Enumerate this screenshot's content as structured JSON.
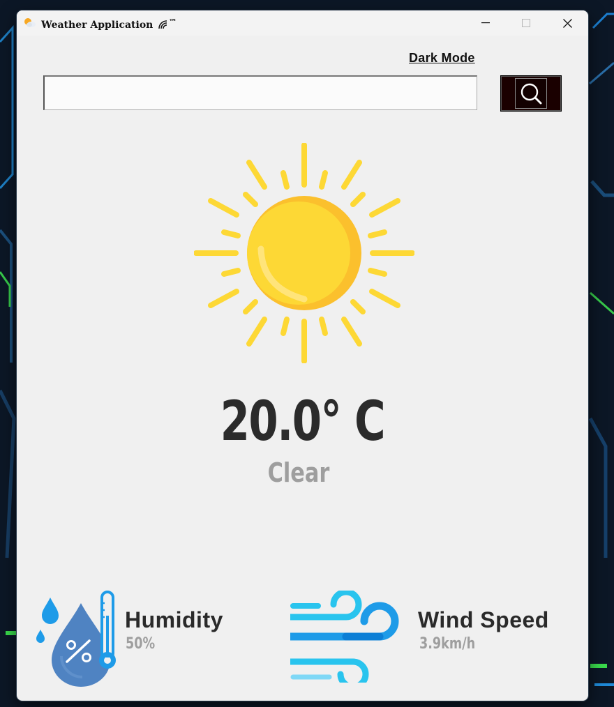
{
  "window": {
    "title": "Weather Application",
    "title_suffix": "™",
    "app_icon": "partly-cloudy-icon",
    "signal_icon": "signal-arcs-icon"
  },
  "window_controls": {
    "minimize_icon": "minimize-icon",
    "maximize_icon": "maximize-icon",
    "close_icon": "close-icon"
  },
  "toolbar": {
    "dark_mode_label": "Dark Mode"
  },
  "search": {
    "value": "",
    "placeholder": "",
    "button_icon": "search-icon",
    "button_bg": "#1a0000"
  },
  "weather": {
    "icon": "sun-icon",
    "temperature": "20.0° C",
    "condition": "Clear"
  },
  "stats": {
    "humidity": {
      "label": "Humidity",
      "value": "50%",
      "icon": "humidity-icon",
      "color": "#4f83c2"
    },
    "wind": {
      "label": "Wind Speed",
      "value": "3.9km/h",
      "icon": "wind-icon",
      "color": "#1e9be8"
    }
  },
  "colors": {
    "window_bg": "#f0f0f0",
    "sun_yellow": "#fdd835",
    "sun_shade": "#fbc02d",
    "temperature_text": "#2b2b2b",
    "secondary_text": "#9e9e9e"
  }
}
